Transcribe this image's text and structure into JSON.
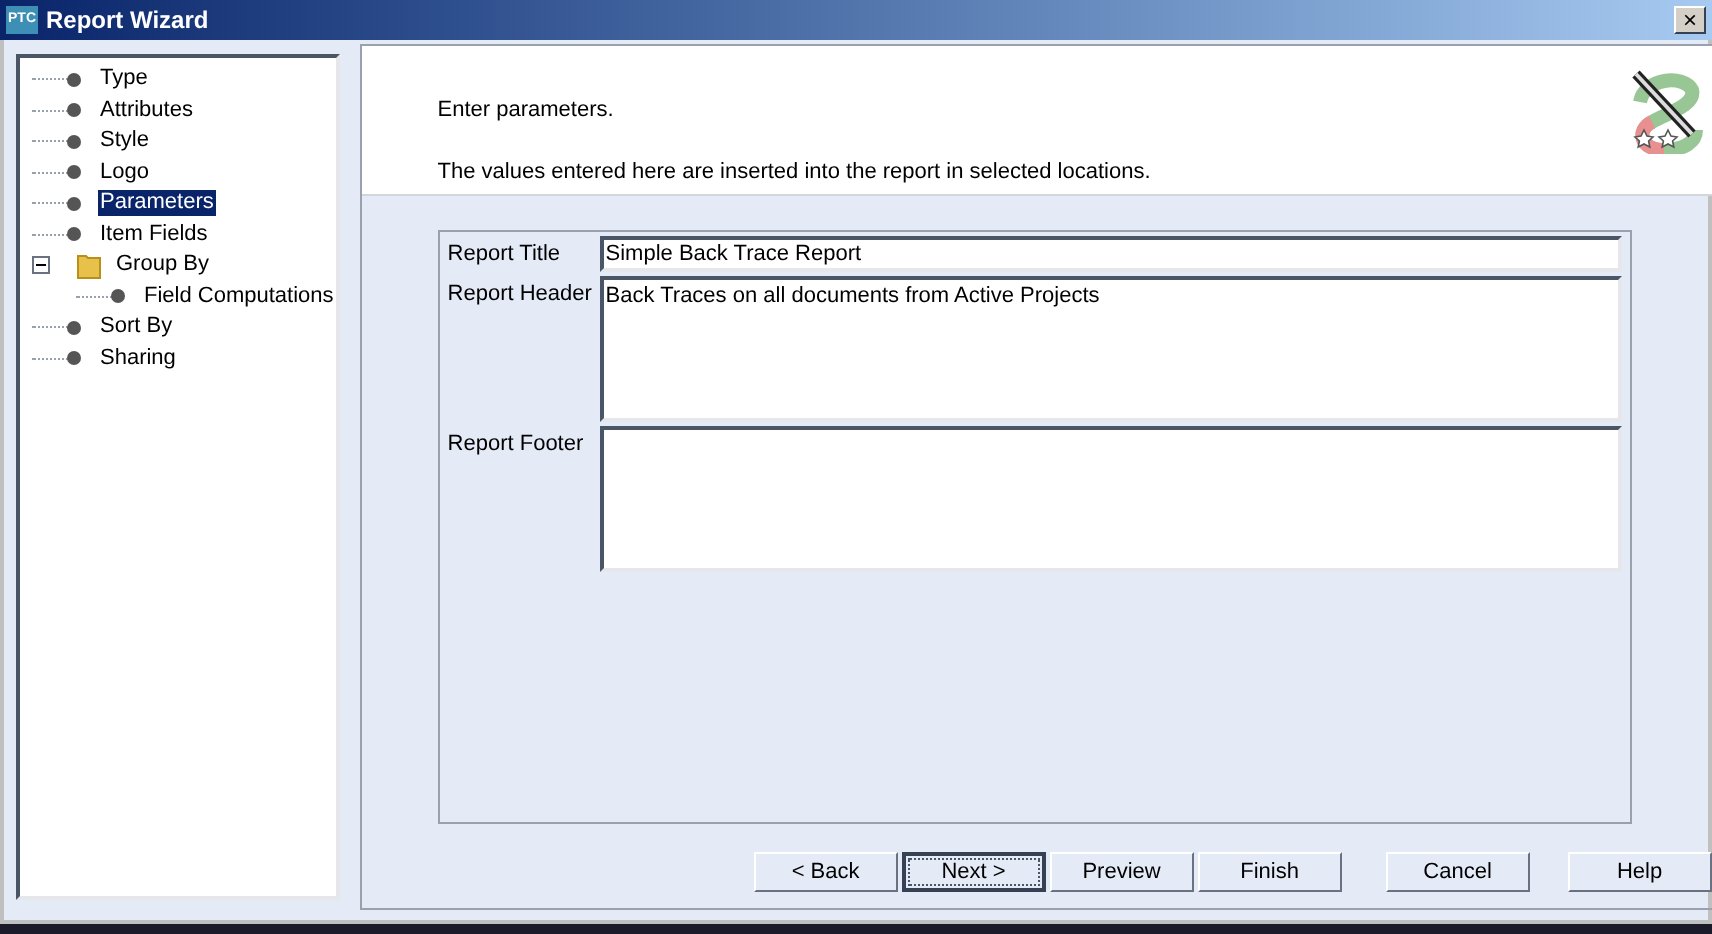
{
  "window": {
    "icon": "PTC",
    "title": "Report Wizard",
    "close": "×"
  },
  "tree": [
    {
      "label": "Type",
      "kind": "leaf",
      "selected": false
    },
    {
      "label": "Attributes",
      "kind": "leaf",
      "selected": false
    },
    {
      "label": "Style",
      "kind": "leaf",
      "selected": false
    },
    {
      "label": "Logo",
      "kind": "leaf",
      "selected": false
    },
    {
      "label": "Parameters",
      "kind": "leaf",
      "selected": true
    },
    {
      "label": "Item Fields",
      "kind": "leaf",
      "selected": false
    },
    {
      "label": "Group By",
      "kind": "folder",
      "selected": false,
      "expanded": true,
      "children": [
        {
          "label": "Field Computations",
          "kind": "leaf",
          "selected": false
        }
      ]
    },
    {
      "label": "Sort By",
      "kind": "leaf",
      "selected": false
    },
    {
      "label": "Sharing",
      "kind": "leaf",
      "selected": false
    }
  ],
  "header": {
    "title": "Enter parameters.",
    "description": "The values entered here are inserted into the report in selected locations."
  },
  "fields": [
    {
      "label": "Report Title",
      "kind": "line",
      "value": "Simple Back Trace Report"
    },
    {
      "label": "Report Header",
      "kind": "area",
      "value": "Back Traces on all documents from Active Projects"
    },
    {
      "label": "Report Footer",
      "kind": "area"
    }
  ],
  "buttons": [
    {
      "label": "< Back",
      "focused": false
    },
    {
      "label": "Next >",
      "focused": true
    },
    {
      "label": "Preview",
      "focused": false
    },
    {
      "label": "Finish",
      "focused": false
    },
    {
      "label": "Cancel",
      "focused": false
    },
    {
      "label": "Help",
      "focused": false
    }
  ]
}
